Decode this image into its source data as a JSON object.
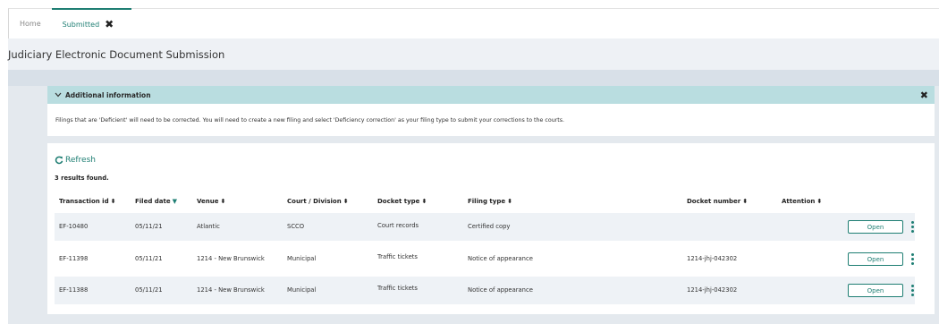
{
  "tabs": [
    {
      "label": "Home",
      "active": false
    },
    {
      "label": "Submitted",
      "active": true,
      "close": "✖"
    }
  ],
  "page_title": "Judiciary Electronic Document Submission",
  "info_panel": {
    "title": "Additional information",
    "close": "✖",
    "text": "Filings that are 'Deficient' will need to be corrected. You will need to create a new filing and select 'Deficiency correction' as your filing type to submit your corrections to the courts."
  },
  "refresh_label": "Refresh",
  "results_text": "3 results found.",
  "columns": [
    {
      "label": "Transaction id",
      "sort": "⬍"
    },
    {
      "label": "Filed date",
      "sort": "▼"
    },
    {
      "label": "Venue",
      "sort": "⬍"
    },
    {
      "label": "Court / Division",
      "sort": "⬍"
    },
    {
      "label": "Docket type",
      "sort": "⬍"
    },
    {
      "label": "Filing type",
      "sort": "⬍"
    },
    {
      "label": "Docket number",
      "sort": "⬍"
    },
    {
      "label": "Attention",
      "sort": "⬍"
    }
  ],
  "rows": [
    {
      "transaction_id": "EF-10480",
      "filed_date": "05/11/21",
      "venue": "Atlantic",
      "court": "SCCO",
      "docket_type": "Court records",
      "filing_type": "Certified copy",
      "docket_number": "",
      "attention": "",
      "action": "Open"
    },
    {
      "transaction_id": "EF-11398",
      "filed_date": "05/11/21",
      "venue": "1214 - New Brunswick",
      "court": "Municipal",
      "docket_type": "Traffic tickets",
      "filing_type": "Notice of appearance",
      "docket_number": "1214-jhj-042302",
      "attention": "",
      "action": "Open"
    },
    {
      "transaction_id": "EF-11388",
      "filed_date": "05/11/21",
      "venue": "1214 - New Brunswick",
      "court": "Municipal",
      "docket_type": "Traffic tickets",
      "filing_type": "Notice of appearance",
      "docket_number": "1214-jhj-042302",
      "attention": "",
      "action": "Open"
    }
  ],
  "colors": {
    "accent": "#1e7e73",
    "info_header_bg": "#b9dde0",
    "row_shade": "#eef2f6",
    "canvas_bg": "#e4e9ee"
  }
}
